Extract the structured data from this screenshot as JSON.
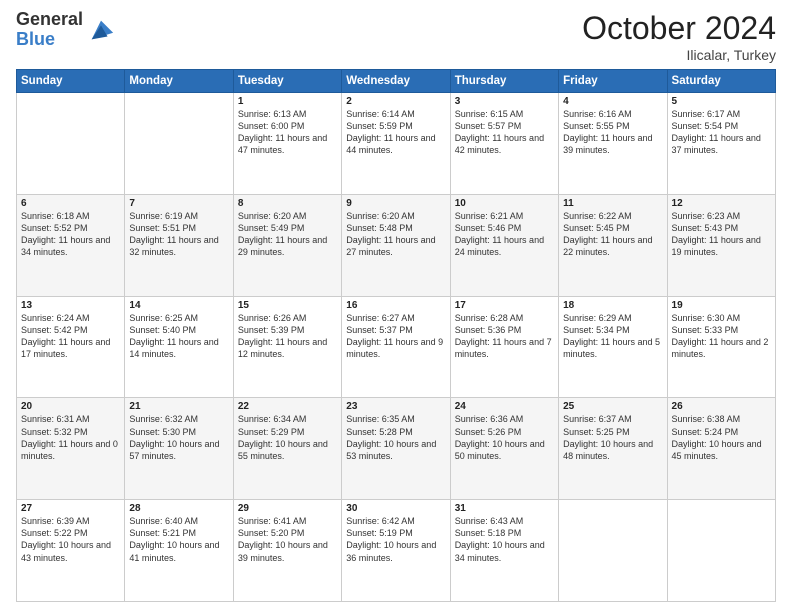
{
  "header": {
    "logo_general": "General",
    "logo_blue": "Blue",
    "month_title": "October 2024",
    "subtitle": "Ilicalar, Turkey"
  },
  "weekdays": [
    "Sunday",
    "Monday",
    "Tuesday",
    "Wednesday",
    "Thursday",
    "Friday",
    "Saturday"
  ],
  "weeks": [
    [
      {
        "day": null,
        "sunrise": null,
        "sunset": null,
        "daylight": null
      },
      {
        "day": null,
        "sunrise": null,
        "sunset": null,
        "daylight": null
      },
      {
        "day": "1",
        "sunrise": "Sunrise: 6:13 AM",
        "sunset": "Sunset: 6:00 PM",
        "daylight": "Daylight: 11 hours and 47 minutes."
      },
      {
        "day": "2",
        "sunrise": "Sunrise: 6:14 AM",
        "sunset": "Sunset: 5:59 PM",
        "daylight": "Daylight: 11 hours and 44 minutes."
      },
      {
        "day": "3",
        "sunrise": "Sunrise: 6:15 AM",
        "sunset": "Sunset: 5:57 PM",
        "daylight": "Daylight: 11 hours and 42 minutes."
      },
      {
        "day": "4",
        "sunrise": "Sunrise: 6:16 AM",
        "sunset": "Sunset: 5:55 PM",
        "daylight": "Daylight: 11 hours and 39 minutes."
      },
      {
        "day": "5",
        "sunrise": "Sunrise: 6:17 AM",
        "sunset": "Sunset: 5:54 PM",
        "daylight": "Daylight: 11 hours and 37 minutes."
      }
    ],
    [
      {
        "day": "6",
        "sunrise": "Sunrise: 6:18 AM",
        "sunset": "Sunset: 5:52 PM",
        "daylight": "Daylight: 11 hours and 34 minutes."
      },
      {
        "day": "7",
        "sunrise": "Sunrise: 6:19 AM",
        "sunset": "Sunset: 5:51 PM",
        "daylight": "Daylight: 11 hours and 32 minutes."
      },
      {
        "day": "8",
        "sunrise": "Sunrise: 6:20 AM",
        "sunset": "Sunset: 5:49 PM",
        "daylight": "Daylight: 11 hours and 29 minutes."
      },
      {
        "day": "9",
        "sunrise": "Sunrise: 6:20 AM",
        "sunset": "Sunset: 5:48 PM",
        "daylight": "Daylight: 11 hours and 27 minutes."
      },
      {
        "day": "10",
        "sunrise": "Sunrise: 6:21 AM",
        "sunset": "Sunset: 5:46 PM",
        "daylight": "Daylight: 11 hours and 24 minutes."
      },
      {
        "day": "11",
        "sunrise": "Sunrise: 6:22 AM",
        "sunset": "Sunset: 5:45 PM",
        "daylight": "Daylight: 11 hours and 22 minutes."
      },
      {
        "day": "12",
        "sunrise": "Sunrise: 6:23 AM",
        "sunset": "Sunset: 5:43 PM",
        "daylight": "Daylight: 11 hours and 19 minutes."
      }
    ],
    [
      {
        "day": "13",
        "sunrise": "Sunrise: 6:24 AM",
        "sunset": "Sunset: 5:42 PM",
        "daylight": "Daylight: 11 hours and 17 minutes."
      },
      {
        "day": "14",
        "sunrise": "Sunrise: 6:25 AM",
        "sunset": "Sunset: 5:40 PM",
        "daylight": "Daylight: 11 hours and 14 minutes."
      },
      {
        "day": "15",
        "sunrise": "Sunrise: 6:26 AM",
        "sunset": "Sunset: 5:39 PM",
        "daylight": "Daylight: 11 hours and 12 minutes."
      },
      {
        "day": "16",
        "sunrise": "Sunrise: 6:27 AM",
        "sunset": "Sunset: 5:37 PM",
        "daylight": "Daylight: 11 hours and 9 minutes."
      },
      {
        "day": "17",
        "sunrise": "Sunrise: 6:28 AM",
        "sunset": "Sunset: 5:36 PM",
        "daylight": "Daylight: 11 hours and 7 minutes."
      },
      {
        "day": "18",
        "sunrise": "Sunrise: 6:29 AM",
        "sunset": "Sunset: 5:34 PM",
        "daylight": "Daylight: 11 hours and 5 minutes."
      },
      {
        "day": "19",
        "sunrise": "Sunrise: 6:30 AM",
        "sunset": "Sunset: 5:33 PM",
        "daylight": "Daylight: 11 hours and 2 minutes."
      }
    ],
    [
      {
        "day": "20",
        "sunrise": "Sunrise: 6:31 AM",
        "sunset": "Sunset: 5:32 PM",
        "daylight": "Daylight: 11 hours and 0 minutes."
      },
      {
        "day": "21",
        "sunrise": "Sunrise: 6:32 AM",
        "sunset": "Sunset: 5:30 PM",
        "daylight": "Daylight: 10 hours and 57 minutes."
      },
      {
        "day": "22",
        "sunrise": "Sunrise: 6:34 AM",
        "sunset": "Sunset: 5:29 PM",
        "daylight": "Daylight: 10 hours and 55 minutes."
      },
      {
        "day": "23",
        "sunrise": "Sunrise: 6:35 AM",
        "sunset": "Sunset: 5:28 PM",
        "daylight": "Daylight: 10 hours and 53 minutes."
      },
      {
        "day": "24",
        "sunrise": "Sunrise: 6:36 AM",
        "sunset": "Sunset: 5:26 PM",
        "daylight": "Daylight: 10 hours and 50 minutes."
      },
      {
        "day": "25",
        "sunrise": "Sunrise: 6:37 AM",
        "sunset": "Sunset: 5:25 PM",
        "daylight": "Daylight: 10 hours and 48 minutes."
      },
      {
        "day": "26",
        "sunrise": "Sunrise: 6:38 AM",
        "sunset": "Sunset: 5:24 PM",
        "daylight": "Daylight: 10 hours and 45 minutes."
      }
    ],
    [
      {
        "day": "27",
        "sunrise": "Sunrise: 6:39 AM",
        "sunset": "Sunset: 5:22 PM",
        "daylight": "Daylight: 10 hours and 43 minutes."
      },
      {
        "day": "28",
        "sunrise": "Sunrise: 6:40 AM",
        "sunset": "Sunset: 5:21 PM",
        "daylight": "Daylight: 10 hours and 41 minutes."
      },
      {
        "day": "29",
        "sunrise": "Sunrise: 6:41 AM",
        "sunset": "Sunset: 5:20 PM",
        "daylight": "Daylight: 10 hours and 39 minutes."
      },
      {
        "day": "30",
        "sunrise": "Sunrise: 6:42 AM",
        "sunset": "Sunset: 5:19 PM",
        "daylight": "Daylight: 10 hours and 36 minutes."
      },
      {
        "day": "31",
        "sunrise": "Sunrise: 6:43 AM",
        "sunset": "Sunset: 5:18 PM",
        "daylight": "Daylight: 10 hours and 34 minutes."
      },
      {
        "day": null,
        "sunrise": null,
        "sunset": null,
        "daylight": null
      },
      {
        "day": null,
        "sunrise": null,
        "sunset": null,
        "daylight": null
      }
    ]
  ]
}
